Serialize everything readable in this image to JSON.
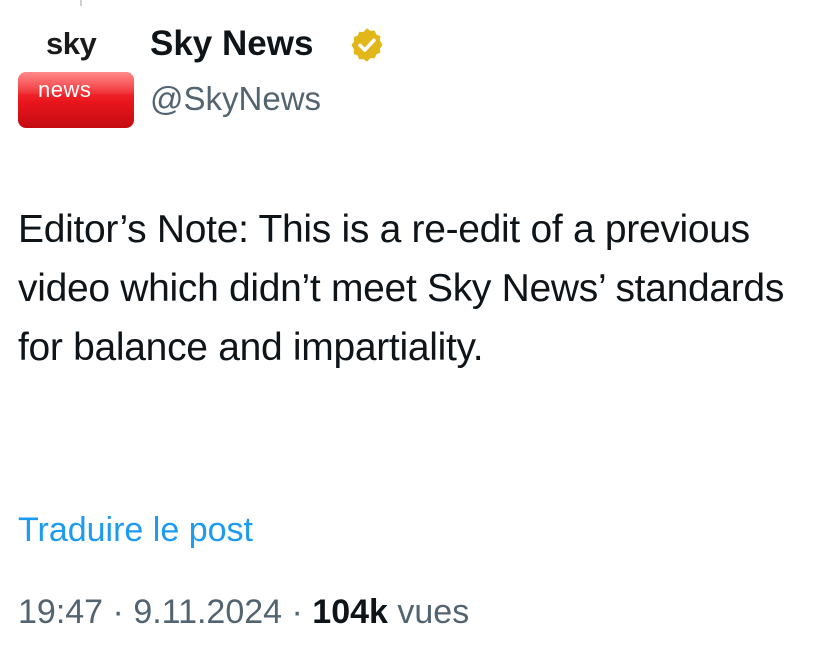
{
  "author": {
    "avatar": {
      "line1": "sky",
      "line2": "news",
      "badge_color": "#e8141c"
    },
    "display_name": "Sky News",
    "handle": "@SkyNews",
    "verified_color": "#e2b719"
  },
  "post": {
    "text": "Editor’s Note: This is a re-edit of a previous video which didn’t meet Sky News’ standards for balance and impartiality.",
    "translate_label": "Traduire le post",
    "time": "19:47",
    "separator": "·",
    "date": "9.11.2024",
    "views_count": "104k",
    "views_label": "vues"
  },
  "colors": {
    "text": "#0f1419",
    "secondary": "#536471",
    "link": "#1d9bf0"
  }
}
